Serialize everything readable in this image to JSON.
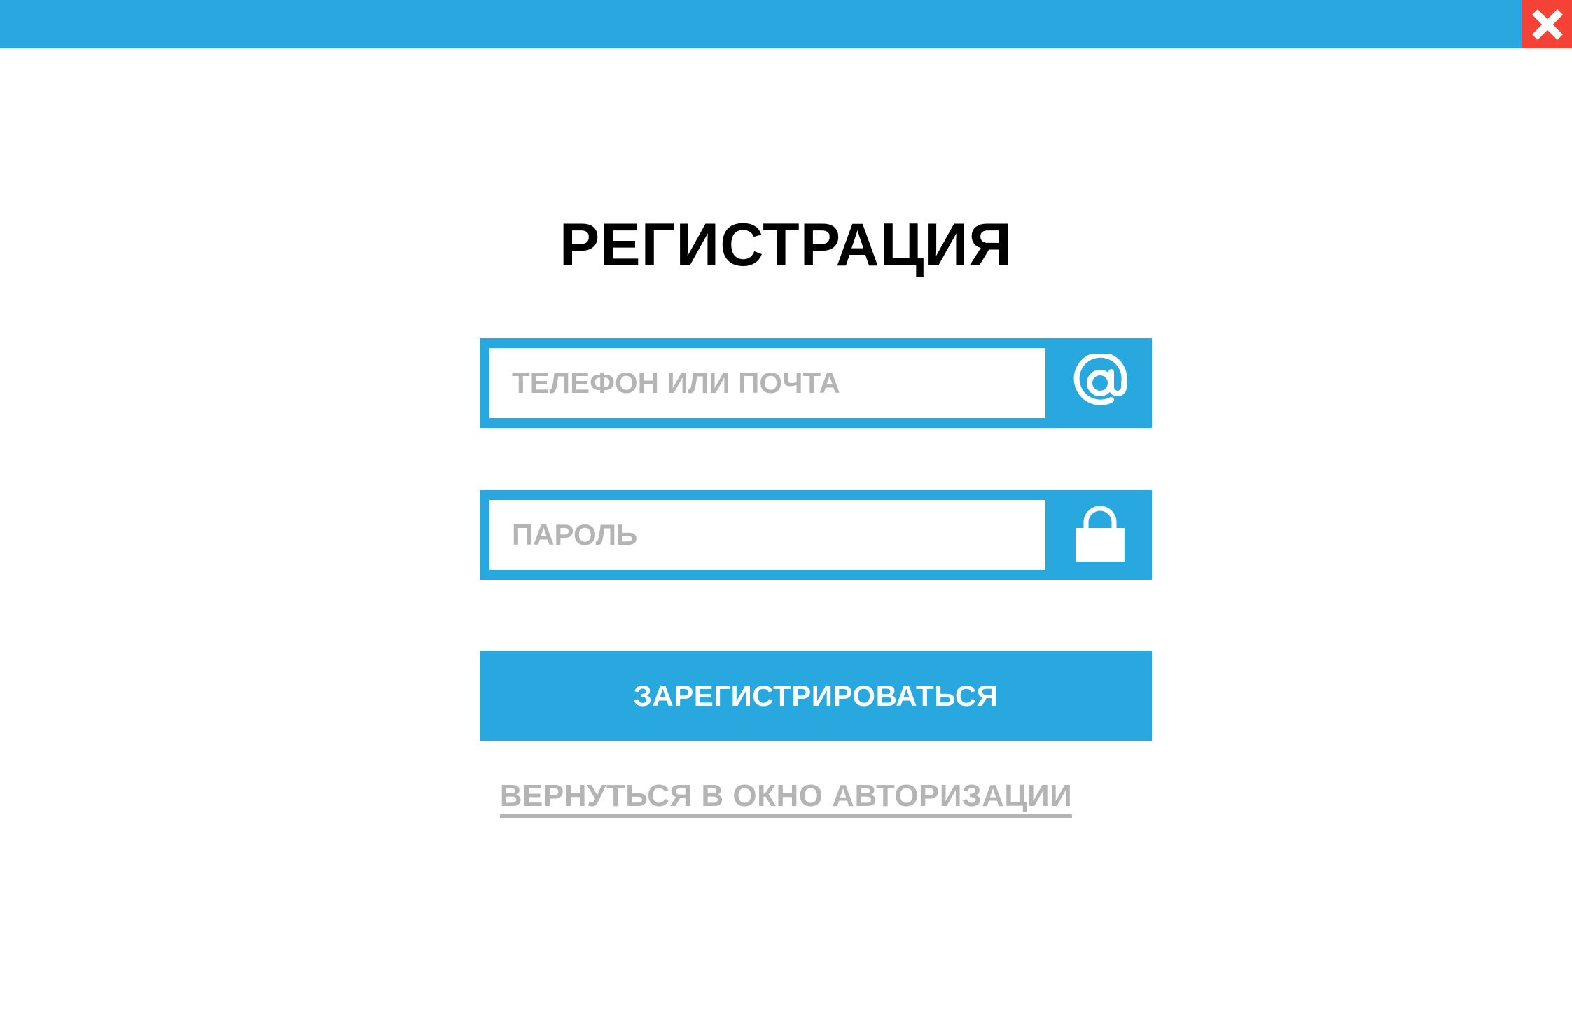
{
  "window": {
    "close_icon": "close-icon",
    "accent_color": "#29a8e0",
    "close_color": "#f44336"
  },
  "form": {
    "title": "РЕГИСТРАЦИЯ",
    "login": {
      "placeholder": "ТЕЛЕФОН ИЛИ ПОЧТА",
      "value": "",
      "icon": "at-sign-icon"
    },
    "password": {
      "placeholder": "ПАРОЛЬ",
      "value": "",
      "icon": "lock-icon"
    },
    "submit_label": "ЗАРЕГИСТРИРОВАТЬСЯ",
    "back_link_label": "ВЕРНУТЬСЯ В ОКНО АВТОРИЗАЦИИ"
  }
}
